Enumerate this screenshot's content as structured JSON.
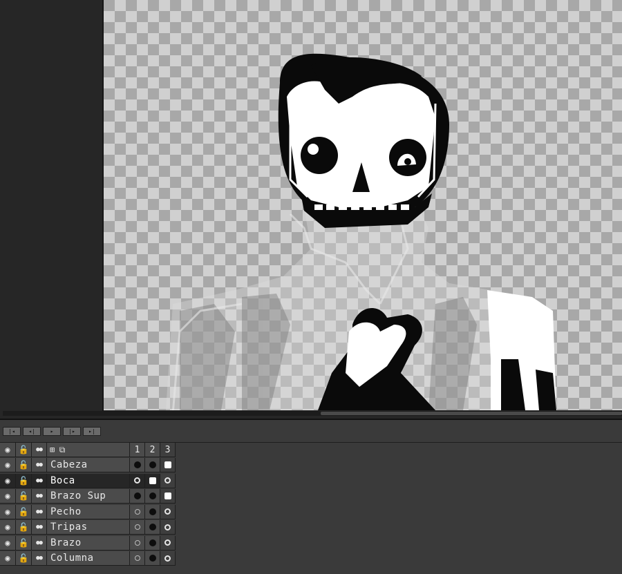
{
  "playback": {
    "buttons": [
      {
        "name": "first-frame-button",
        "glyph": "|◂"
      },
      {
        "name": "prev-frame-button",
        "glyph": "◂|"
      },
      {
        "name": "play-button",
        "glyph": "▸"
      },
      {
        "name": "next-frame-button",
        "glyph": "|▸"
      },
      {
        "name": "last-frame-button",
        "glyph": "▸|"
      }
    ]
  },
  "timeline": {
    "frame_numbers": [
      "1",
      "2",
      "3"
    ],
    "current_frame": 3,
    "header_icons": [
      "eye-icon",
      "lock-icon",
      "onion-skin-icon",
      "link-icon",
      "new-layer-icon"
    ],
    "layers": [
      {
        "name": "Cabeza",
        "cels": [
          "dot",
          "dot",
          "square"
        ],
        "active": false
      },
      {
        "name": "Boca",
        "cels": [
          "ring",
          "square",
          "ring"
        ],
        "active": true
      },
      {
        "name": "Brazo Sup",
        "cels": [
          "dot",
          "dot",
          "square"
        ],
        "active": false
      },
      {
        "name": "Pecho",
        "cels": [
          "ring-dim",
          "dot",
          "ring"
        ],
        "active": false
      },
      {
        "name": "Tripas",
        "cels": [
          "ring-dim",
          "dot",
          "ring"
        ],
        "active": false
      },
      {
        "name": "Brazo",
        "cels": [
          "ring-dim",
          "dot",
          "ring"
        ],
        "active": false
      },
      {
        "name": "Columna",
        "cels": [
          "ring-dim",
          "dot",
          "ring"
        ],
        "active": false
      }
    ]
  },
  "colors": {
    "panel": "#3a3a3a",
    "cell": "#4b4b4b",
    "active_row": "#262626",
    "checker_light": "#d0d0d0",
    "checker_dark": "#a8a8a8"
  }
}
